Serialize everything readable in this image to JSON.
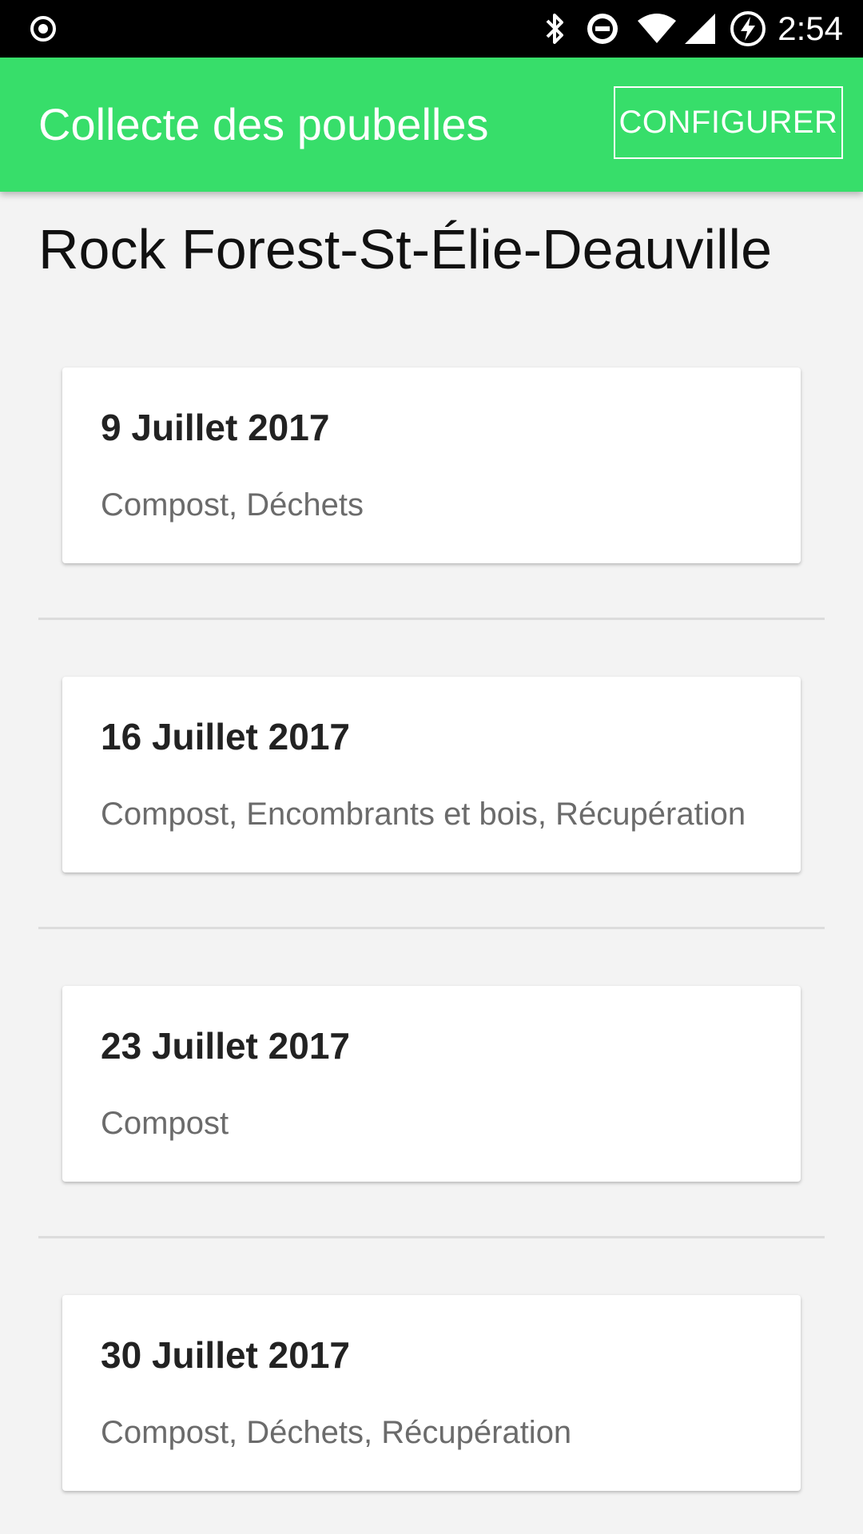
{
  "status_bar": {
    "time": "2:54",
    "icons": [
      "circle-dot-icon",
      "bluetooth-icon",
      "do-not-disturb-icon",
      "wifi-icon",
      "cell-signal-icon",
      "battery-charging-icon"
    ]
  },
  "app_bar": {
    "title": "Collecte des poubelles",
    "configure_label": "CONFIGURER",
    "color": "#37de6a"
  },
  "location": "Rock Forest-St-Élie-Deauville",
  "collections": [
    {
      "date": "9 Juillet 2017",
      "types": "Compost, Déchets"
    },
    {
      "date": "16 Juillet 2017",
      "types": "Compost, Encombrants et bois, Récupération"
    },
    {
      "date": "23 Juillet 2017",
      "types": "Compost"
    },
    {
      "date": "30 Juillet 2017",
      "types": "Compost, Déchets, Récupération"
    }
  ]
}
